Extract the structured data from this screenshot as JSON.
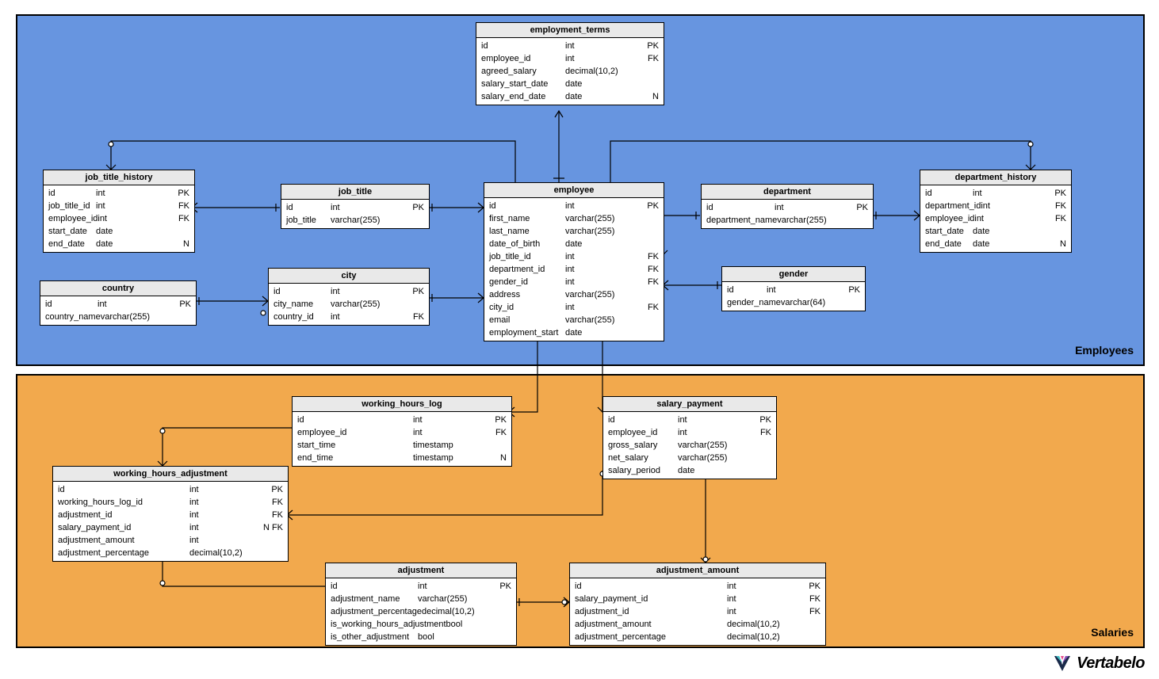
{
  "areas": {
    "employees": {
      "label": "Employees"
    },
    "salaries": {
      "label": "Salaries"
    }
  },
  "logo": {
    "text": "Vertabelo"
  },
  "entities": {
    "employment_terms": {
      "title": "employment_terms",
      "cols": [
        {
          "n": "id",
          "t": "int",
          "k": "PK"
        },
        {
          "n": "employee_id",
          "t": "int",
          "k": "FK"
        },
        {
          "n": "agreed_salary",
          "t": "decimal(10,2)",
          "k": ""
        },
        {
          "n": "salary_start_date",
          "t": "date",
          "k": ""
        },
        {
          "n": "salary_end_date",
          "t": "date",
          "k": "N"
        }
      ]
    },
    "job_title_history": {
      "title": "job_title_history",
      "cols": [
        {
          "n": "id",
          "t": "int",
          "k": "PK"
        },
        {
          "n": "job_title_id",
          "t": "int",
          "k": "FK"
        },
        {
          "n": "employee_id",
          "t": "int",
          "k": "FK"
        },
        {
          "n": "start_date",
          "t": "date",
          "k": ""
        },
        {
          "n": "end_date",
          "t": "date",
          "k": "N"
        }
      ]
    },
    "job_title": {
      "title": "job_title",
      "cols": [
        {
          "n": "id",
          "t": "int",
          "k": "PK"
        },
        {
          "n": "job_title",
          "t": "varchar(255)",
          "k": ""
        }
      ]
    },
    "employee": {
      "title": "employee",
      "cols": [
        {
          "n": "id",
          "t": "int",
          "k": "PK"
        },
        {
          "n": "first_name",
          "t": "varchar(255)",
          "k": ""
        },
        {
          "n": "last_name",
          "t": "varchar(255)",
          "k": ""
        },
        {
          "n": "date_of_birth",
          "t": "date",
          "k": ""
        },
        {
          "n": "job_title_id",
          "t": "int",
          "k": "FK"
        },
        {
          "n": "department_id",
          "t": "int",
          "k": "FK"
        },
        {
          "n": "gender_id",
          "t": "int",
          "k": "FK"
        },
        {
          "n": "address",
          "t": "varchar(255)",
          "k": ""
        },
        {
          "n": "city_id",
          "t": "int",
          "k": "FK"
        },
        {
          "n": "email",
          "t": "varchar(255)",
          "k": ""
        },
        {
          "n": "employment_start",
          "t": "date",
          "k": ""
        }
      ]
    },
    "department": {
      "title": "department",
      "cols": [
        {
          "n": "id",
          "t": "int",
          "k": "PK"
        },
        {
          "n": "department_name",
          "t": "varchar(255)",
          "k": ""
        }
      ]
    },
    "department_history": {
      "title": "department_history",
      "cols": [
        {
          "n": "id",
          "t": "int",
          "k": "PK"
        },
        {
          "n": "department_id",
          "t": "int",
          "k": "FK"
        },
        {
          "n": "employee_id",
          "t": "int",
          "k": "FK"
        },
        {
          "n": "start_date",
          "t": "date",
          "k": ""
        },
        {
          "n": "end_date",
          "t": "date",
          "k": "N"
        }
      ]
    },
    "country": {
      "title": "country",
      "cols": [
        {
          "n": "id",
          "t": "int",
          "k": "PK"
        },
        {
          "n": "country_name",
          "t": "varchar(255)",
          "k": ""
        }
      ]
    },
    "city": {
      "title": "city",
      "cols": [
        {
          "n": "id",
          "t": "int",
          "k": "PK"
        },
        {
          "n": "city_name",
          "t": "varchar(255)",
          "k": ""
        },
        {
          "n": "country_id",
          "t": "int",
          "k": "FK"
        }
      ]
    },
    "gender": {
      "title": "gender",
      "cols": [
        {
          "n": "id",
          "t": "int",
          "k": "PK"
        },
        {
          "n": "gender_name",
          "t": "varchar(64)",
          "k": ""
        }
      ]
    },
    "working_hours_log": {
      "title": "working_hours_log",
      "cols": [
        {
          "n": "id",
          "t": "int",
          "k": "PK"
        },
        {
          "n": "employee_id",
          "t": "int",
          "k": "FK"
        },
        {
          "n": "start_time",
          "t": "timestamp",
          "k": ""
        },
        {
          "n": "end_time",
          "t": "timestamp",
          "k": "N"
        }
      ]
    },
    "salary_payment": {
      "title": "salary_payment",
      "cols": [
        {
          "n": "id",
          "t": "int",
          "k": "PK"
        },
        {
          "n": "employee_id",
          "t": "int",
          "k": "FK"
        },
        {
          "n": "gross_salary",
          "t": "varchar(255)",
          "k": ""
        },
        {
          "n": "net_salary",
          "t": "varchar(255)",
          "k": ""
        },
        {
          "n": "salary_period",
          "t": "date",
          "k": ""
        }
      ]
    },
    "working_hours_adjustment": {
      "title": "working_hours_adjustment",
      "cols": [
        {
          "n": "id",
          "t": "int",
          "k": "PK"
        },
        {
          "n": "working_hours_log_id",
          "t": "int",
          "k": "FK"
        },
        {
          "n": "adjustment_id",
          "t": "int",
          "k": "FK"
        },
        {
          "n": "salary_payment_id",
          "t": "int",
          "k": "N FK"
        },
        {
          "n": "adjustment_amount",
          "t": "int",
          "k": ""
        },
        {
          "n": "adjustment_percentage",
          "t": "decimal(10,2)",
          "k": ""
        }
      ]
    },
    "adjustment": {
      "title": "adjustment",
      "cols": [
        {
          "n": "id",
          "t": "int",
          "k": "PK"
        },
        {
          "n": "adjustment_name",
          "t": "varchar(255)",
          "k": ""
        },
        {
          "n": "adjustment_percentage",
          "t": "decimal(10,2)",
          "k": ""
        },
        {
          "n": "is_working_hours_adjustment",
          "t": "bool",
          "k": ""
        },
        {
          "n": "is_other_adjustment",
          "t": "bool",
          "k": ""
        }
      ]
    },
    "adjustment_amount": {
      "title": "adjustment_amount",
      "cols": [
        {
          "n": "id",
          "t": "int",
          "k": "PK"
        },
        {
          "n": "salary_payment_id",
          "t": "int",
          "k": "FK"
        },
        {
          "n": "adjustment_id",
          "t": "int",
          "k": "FK"
        },
        {
          "n": "adjustment_amount",
          "t": "decimal(10,2)",
          "k": ""
        },
        {
          "n": "adjustment_percentage",
          "t": "decimal(10,2)",
          "k": ""
        }
      ]
    }
  },
  "meta": {
    "subject": "HR / Payroll ER diagram with Employees and Salaries subject areas"
  }
}
